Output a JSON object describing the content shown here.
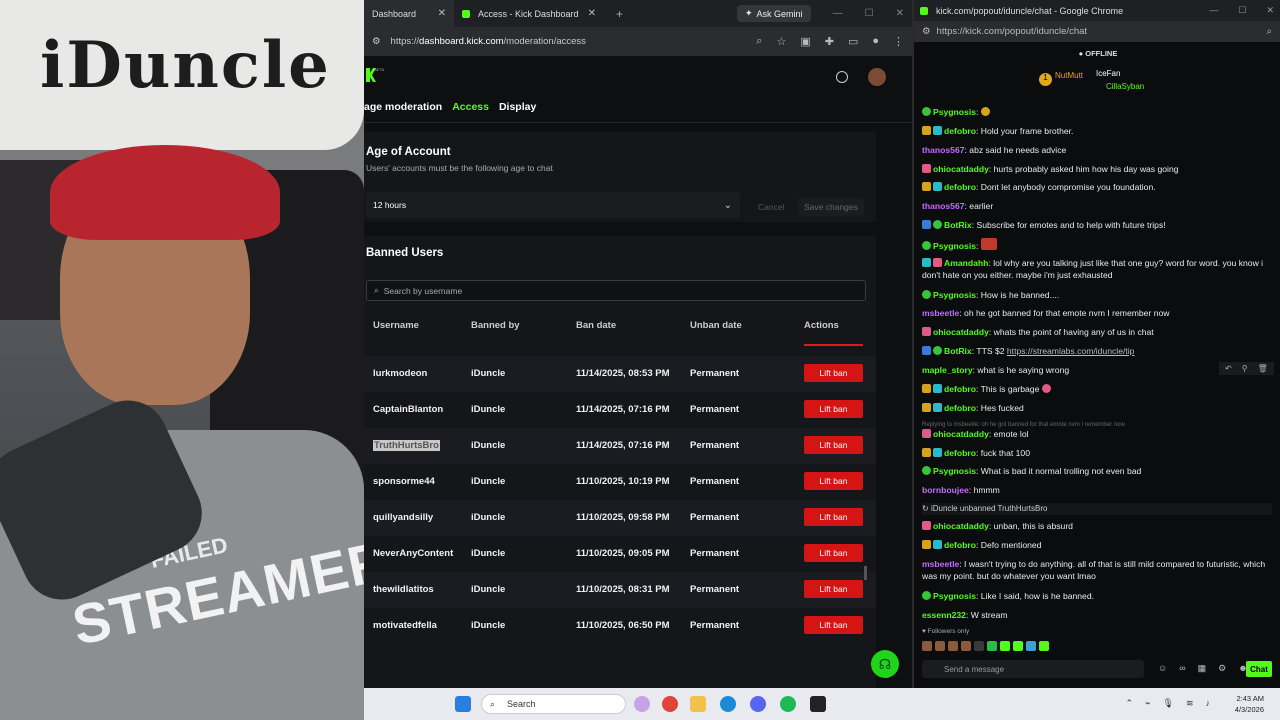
{
  "browser": {
    "tabs": [
      {
        "label": "Dashboard",
        "active": true
      },
      {
        "label": "Access - Kick Dashboard",
        "active": false
      }
    ],
    "new_tab": "+",
    "gemini_label": "Ask Gemini",
    "url_prefix": "https://",
    "url_domain": "dashboard.kick.com",
    "url_path": "/moderation/access"
  },
  "page": {
    "beta": "BETA",
    "subnav": {
      "moderation": "age moderation",
      "access": "Access",
      "display": "Display"
    },
    "age": {
      "title": "Age of Account",
      "subtitle": "Users' accounts must be the following age to chat",
      "selected": "12 hours",
      "cancel_label": "Cancel",
      "save_label": "Save changes"
    },
    "banned": {
      "title": "Banned Users",
      "search_placeholder": "Search by username",
      "columns": [
        "Username",
        "Banned by",
        "Ban date",
        "Unban date",
        "Actions"
      ],
      "rows": [
        {
          "username": "lurkmodeon",
          "by": "iDuncle",
          "date": "11/14/2025, 08:53 PM",
          "unban": "Permanent",
          "action": "Lift ban"
        },
        {
          "username": "CaptainBlanton",
          "by": "iDuncle",
          "date": "11/14/2025, 07:16 PM",
          "unban": "Permanent",
          "action": "Lift ban"
        },
        {
          "username": "TruthHurtsBro",
          "by": "iDuncle",
          "date": "11/14/2025, 07:16 PM",
          "unban": "Permanent",
          "action": "Lift ban"
        },
        {
          "username": "sponsorme44",
          "by": "iDuncle",
          "date": "11/10/2025, 10:19 PM",
          "unban": "Permanent",
          "action": "Lift ban"
        },
        {
          "username": "quillyandsilly",
          "by": "iDuncle",
          "date": "11/10/2025, 09:58 PM",
          "unban": "Permanent",
          "action": "Lift ban"
        },
        {
          "username": "NeverAnyContent",
          "by": "iDuncle",
          "date": "11/10/2025, 09:05 PM",
          "unban": "Permanent",
          "action": "Lift ban"
        },
        {
          "username": "thewildlatitos",
          "by": "iDuncle",
          "date": "11/10/2025, 08:31 PM",
          "unban": "Permanent",
          "action": "Lift ban"
        },
        {
          "username": "motivatedfella",
          "by": "iDuncle",
          "date": "11/10/2025, 06:50 PM",
          "unban": "Permanent",
          "action": "Lift ban"
        }
      ]
    }
  },
  "webcam": {
    "sign_text": "iDuncle",
    "shirt_text": "STREAMER",
    "shirt_text_small": "FAILED"
  },
  "chat_window": {
    "title": "kick.com/popout/iduncle/chat - Google Chrome",
    "url": "https://kick.com/popout/iduncle/chat",
    "status": "OFFLINE",
    "leaders": [
      {
        "name": "NutMutt",
        "count": "1"
      },
      {
        "name": "IceFan",
        "count": "1"
      },
      {
        "name": "CillaSyban",
        "count": "1"
      }
    ],
    "messages": [
      {
        "user": "Psygnosis",
        "color": "#53fc18",
        "text": ""
      },
      {
        "user": "defobro",
        "color": "#53fc18",
        "text": "Hold your frame brother."
      },
      {
        "user": "thanos567",
        "color": "#c56bff",
        "text": "abz said he needs advice"
      },
      {
        "user": "ohiocatdaddy",
        "color": "#53fc18",
        "text": "hurts probably asked him how his day was going"
      },
      {
        "user": "defobro",
        "color": "#53fc18",
        "text": "Dont let anybody compromise you foundation."
      },
      {
        "user": "thanos567",
        "color": "#c56bff",
        "text": "earlier"
      },
      {
        "user": "BotRix",
        "color": "#53fc18",
        "text": "Subscribe for emotes and to help with future trips!"
      },
      {
        "user": "Psygnosis",
        "color": "#53fc18",
        "text": ""
      },
      {
        "user": "Amandahh",
        "color": "#53fc18",
        "text": "lol why are you talking just like that one guy? word for word. you know i don't hate on you either. maybe i'm just exhausted"
      },
      {
        "user": "Psygnosis",
        "color": "#53fc18",
        "text": "How is he banned...."
      },
      {
        "user": "msbeetle",
        "color": "#c56bff",
        "text": "oh he got banned for that emote nvm I remember now"
      },
      {
        "user": "ohiocatdaddy",
        "color": "#53fc18",
        "text": "whats the point of having any of us in chat"
      },
      {
        "user": "BotRix",
        "color": "#53fc18",
        "text": "TTS $2 ",
        "link": "https://streamlabs.com/iduncle/tip"
      },
      {
        "user": "maple_story",
        "color": "#53fc18",
        "text": "what is he saying wrong"
      },
      {
        "user": "defobro",
        "color": "#53fc18",
        "text": "This is garbage"
      },
      {
        "user": "defobro",
        "color": "#53fc18",
        "text": "Hes fucked"
      },
      {
        "reply": "Replying to msbeetle: oh he got banned for that emote nvm I remember now"
      },
      {
        "user": "ohiocatdaddy",
        "color": "#53fc18",
        "text": "emote lol"
      },
      {
        "user": "defobro",
        "color": "#53fc18",
        "text": "fuck that 100"
      },
      {
        "user": "Psygnosis",
        "color": "#53fc18",
        "text": "What is bad it normal trolling not even bad"
      },
      {
        "user": "bornboujee",
        "color": "#c56bff",
        "text": "hmmm"
      },
      {
        "system": "iDuncle unbanned TruthHurtsBro"
      },
      {
        "user": "ohiocatdaddy",
        "color": "#53fc18",
        "text": "unban, this is absurd"
      },
      {
        "user": "defobro",
        "color": "#53fc18",
        "text": "Defo mentioned"
      },
      {
        "user": "msbeetle",
        "color": "#c56bff",
        "text": "I wasn't trying to do anything. all of that is still mild compared to futuristic, which was my point. but do whatever you want lmao"
      },
      {
        "user": "Psygnosis",
        "color": "#53fc18",
        "text": "Like I said, how is he banned."
      },
      {
        "user": "essenn232",
        "color": "#53fc18",
        "text": "W stream"
      }
    ],
    "followers_only": "Followers only",
    "input_placeholder": "Send a message",
    "chat_button": "Chat"
  },
  "taskbar": {
    "search_label": "Search",
    "time": "2:43 AM",
    "date": "4/3/2026"
  }
}
